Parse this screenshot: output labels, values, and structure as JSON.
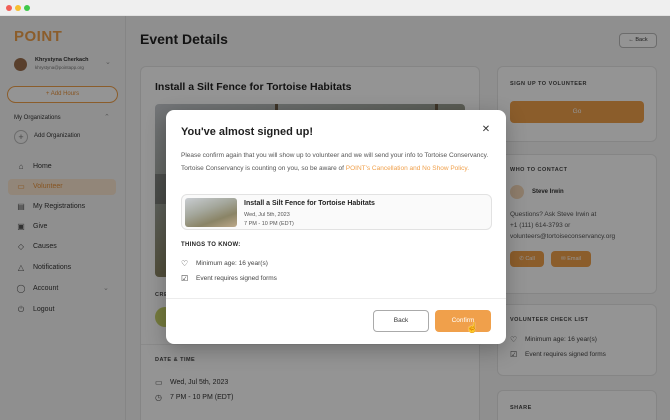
{
  "sidebar": {
    "logo": "POINT",
    "user_name": "Khrystyna Cherkach",
    "user_email": "khrystyna@pointapp.org",
    "add_hours": "Add Hours",
    "orgs_label": "My Organizations",
    "add_org": "Add Organization",
    "nav": [
      {
        "label": "Home",
        "icon": "home-icon"
      },
      {
        "label": "Volunteer",
        "icon": "calendar-icon"
      },
      {
        "label": "My Registrations",
        "icon": "ticket-icon"
      },
      {
        "label": "Give",
        "icon": "gift-icon"
      },
      {
        "label": "Causes",
        "icon": "tag-icon"
      },
      {
        "label": "Notifications",
        "icon": "bell-icon"
      },
      {
        "label": "Account",
        "icon": "user-icon"
      },
      {
        "label": "Logout",
        "icon": "power-icon"
      }
    ],
    "active_nav": "Volunteer"
  },
  "main": {
    "page_title": "Event Details",
    "back_label": "Back",
    "event_title": "Install a Silt Fence for Tortoise Habitats",
    "crew_label": "CRE",
    "date_time_label": "DATE & TIME",
    "date": "Wed, Jul 5th, 2023",
    "time": "7 PM - 10 PM (EDT)"
  },
  "right": {
    "signup_title": "SIGN UP TO VOLUNTEER",
    "go_label": "Go",
    "contact_title": "WHO TO CONTACT",
    "contact_name": "Steve Irwin",
    "contact_line1": "Questions? Ask Steve Irwin at",
    "contact_phone": "+1 (111) 614-3793 or",
    "contact_email": "volunteers@tortoiseconservancy.org",
    "call_label": "Call",
    "email_label": "Email",
    "checklist_title": "VOLUNTEER CHECK LIST",
    "checklist": [
      "Minimum age: 16 year(s)",
      "Event requires signed forms"
    ],
    "share_title": "SHARE"
  },
  "modal": {
    "title": "You've almost signed up!",
    "body": "Please confirm again that you will show up to volunteer and we will send your info to Tortoise Conservancy. Tortoise Conservancy is counting on you, so be aware of",
    "policy_link": "POINT's Cancellation and No Show Policy.",
    "event_title": "Install a Silt Fence for Tortoise Habitats",
    "event_date": "Wed, Jul 5th, 2023",
    "event_time": "7 PM - 10 PM (EDT)",
    "things_label": "THINGS TO KNOW:",
    "things": [
      "Minimum age: 16 year(s)",
      "Event requires signed forms"
    ],
    "back_label": "Back",
    "confirm_label": "Confirm"
  },
  "colors": {
    "accent": "#f0a04b",
    "active_nav_bg": "#fbe7d1",
    "overlay": "rgba(0,0,0,0.42)"
  }
}
